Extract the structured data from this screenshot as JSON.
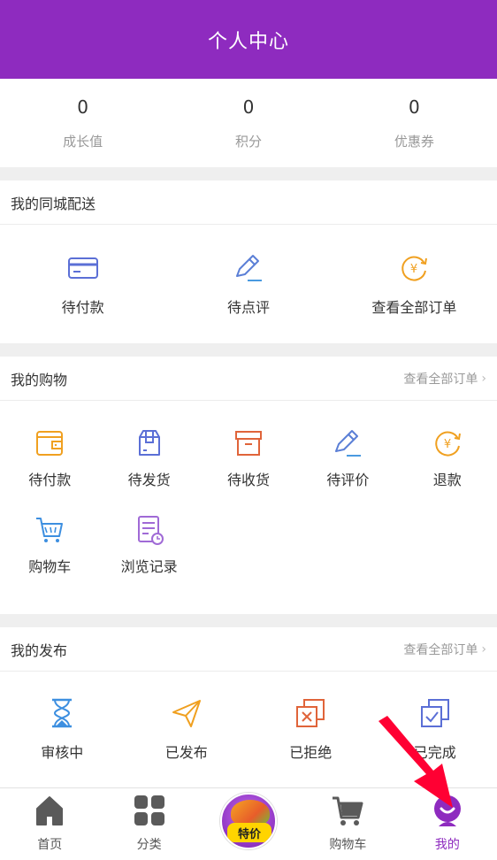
{
  "header": {
    "title": "个人中心"
  },
  "stats": [
    {
      "value": "0",
      "label": "成长值"
    },
    {
      "value": "0",
      "label": "积分"
    },
    {
      "value": "0",
      "label": "优惠券"
    }
  ],
  "delivery": {
    "title": "我的同城配送",
    "items": [
      {
        "label": "待付款",
        "icon": "card-icon"
      },
      {
        "label": "待点评",
        "icon": "pen-icon"
      },
      {
        "label": "查看全部订单",
        "icon": "yen-refresh-icon"
      }
    ]
  },
  "shopping": {
    "title": "我的购物",
    "more": "查看全部订单",
    "items": [
      {
        "label": "待付款",
        "icon": "wallet-icon"
      },
      {
        "label": "待发货",
        "icon": "package-icon"
      },
      {
        "label": "待收货",
        "icon": "box-icon"
      },
      {
        "label": "待评价",
        "icon": "pen-icon"
      },
      {
        "label": "退款",
        "icon": "yen-refresh-icon"
      },
      {
        "label": "购物车",
        "icon": "cart-icon"
      },
      {
        "label": "浏览记录",
        "icon": "history-icon"
      }
    ]
  },
  "publish": {
    "title": "我的发布",
    "more": "查看全部订单",
    "items": [
      {
        "label": "审核中",
        "icon": "hourglass-icon"
      },
      {
        "label": "已发布",
        "icon": "paper-plane-icon"
      },
      {
        "label": "已拒绝",
        "icon": "rejected-icon"
      },
      {
        "label": "已完成",
        "icon": "completed-icon"
      }
    ]
  },
  "tabbar": {
    "items": [
      {
        "label": "首页",
        "icon": "home-icon"
      },
      {
        "label": "分类",
        "icon": "grid-icon"
      },
      {
        "label": "特价",
        "icon": "special-offer-icon"
      },
      {
        "label": "购物车",
        "icon": "cart-icon"
      },
      {
        "label": "我的",
        "icon": "profile-icon",
        "active": true
      }
    ]
  },
  "colors": {
    "brand": "#8e2bbf",
    "arrow": "#ff0033"
  }
}
